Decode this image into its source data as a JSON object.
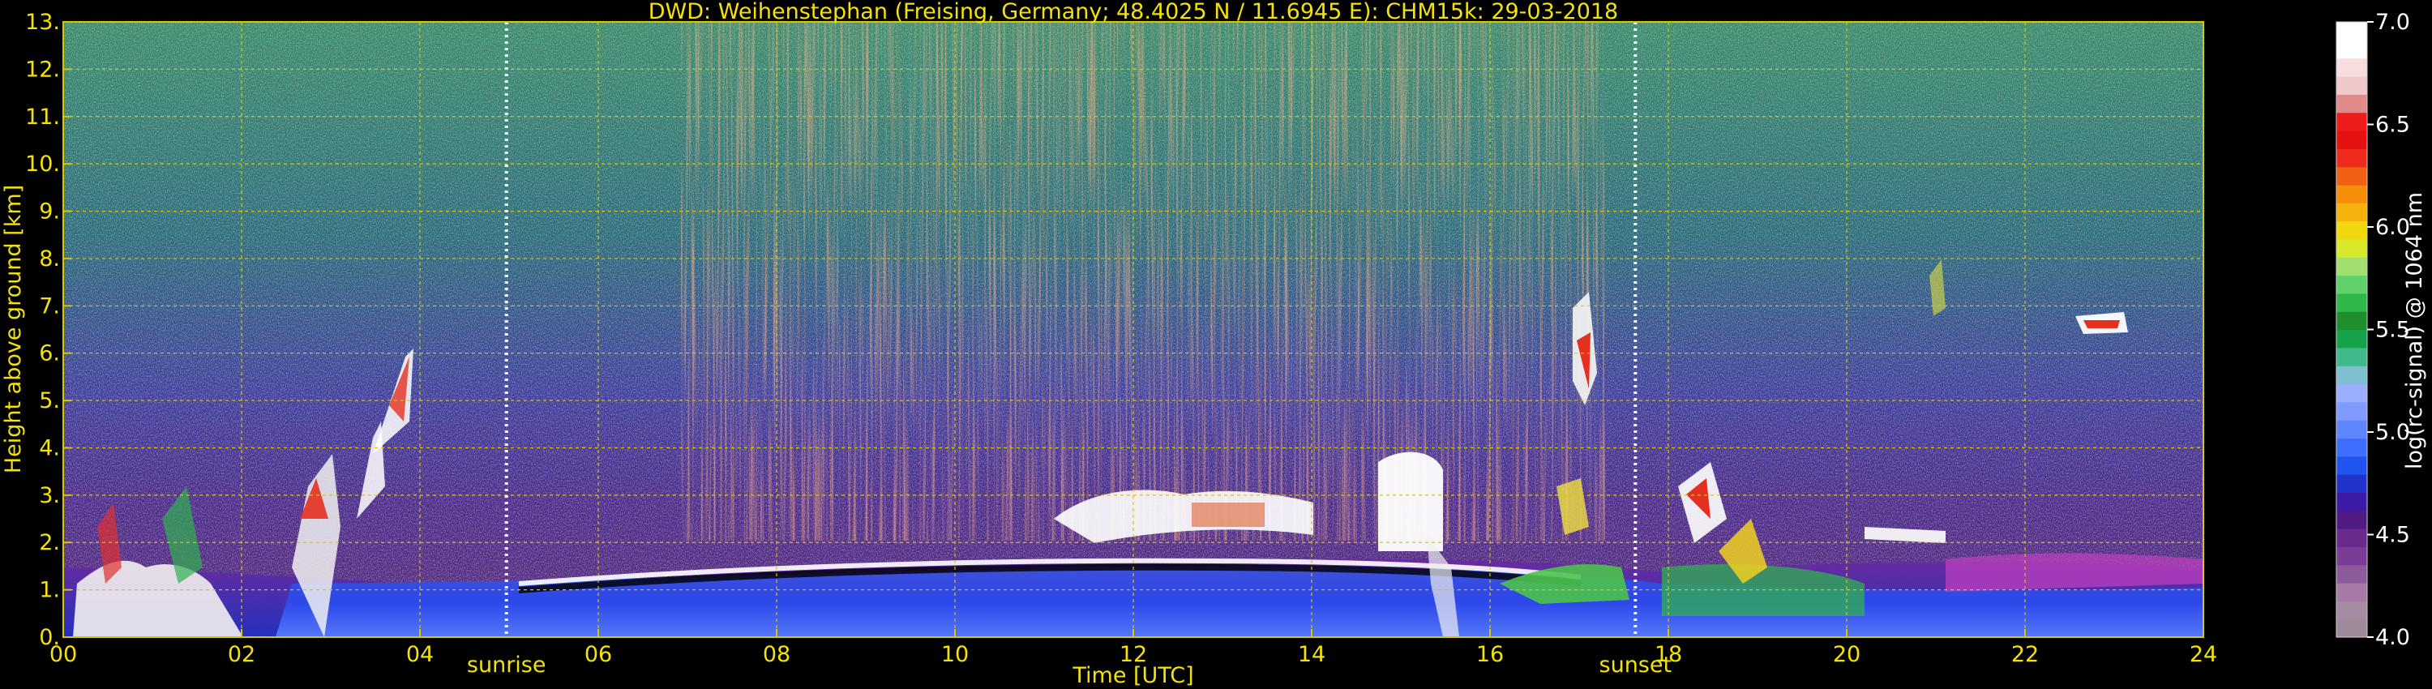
{
  "chart_data": {
    "type": "heatmap",
    "title": "DWD: Weihenstephan (Freising, Germany; 48.4025 N / 11.6945 E):    CHM15k: 29-03-2018",
    "xlabel": "Time [UTC]",
    "ylabel": "Height above ground [km]",
    "xlim": [
      0,
      24
    ],
    "ylim": [
      0,
      13
    ],
    "x_ticks": [
      "00",
      "02",
      "04",
      "06",
      "08",
      "10",
      "12",
      "14",
      "16",
      "18",
      "20",
      "22",
      "24"
    ],
    "y_ticks": [
      "0.",
      "1.",
      "2.",
      "3.",
      "4.",
      "5.",
      "6.",
      "7.",
      "8.",
      "9.",
      "10.",
      "11.",
      "12.",
      "13."
    ],
    "grid": true,
    "markers": [
      {
        "label": "sunrise",
        "time": 4.97
      },
      {
        "label": "sunset",
        "time": 17.63
      }
    ],
    "colorbar": {
      "label": "log(rc-signal) @ 1064 nm",
      "range": [
        4.0,
        7.0
      ],
      "ticks": [
        "4.0",
        "4.5",
        "5.0",
        "5.5",
        "6.0",
        "6.5",
        "7.0"
      ],
      "colors": [
        "#9e8a9a",
        "#a48ba2",
        "#a77aa5",
        "#8d5a9c",
        "#7a3c95",
        "#6a2a8c",
        "#4f1c86",
        "#3b1aa6",
        "#2233cc",
        "#1f55ee",
        "#3d6fff",
        "#5f86ff",
        "#7f9bff",
        "#98b0ff",
        "#7fc0d0",
        "#3fb98a",
        "#15a24a",
        "#1d8f2e",
        "#2fb84a",
        "#5fd06a",
        "#9fe070",
        "#d7e92a",
        "#f0d80f",
        "#f5b20a",
        "#f58f0a",
        "#f06014",
        "#ee2b1c",
        "#e51010",
        "#ee1c1c",
        "#e28a8a",
        "#f0c8c8",
        "#f7dede",
        "#ffffff",
        "#ffffff"
      ]
    }
  },
  "theme": {
    "text_color": "#f2e20a",
    "grid_color": "#d9c800",
    "marker_color": "#ffffff",
    "colorbar_text": "#ffffff"
  }
}
